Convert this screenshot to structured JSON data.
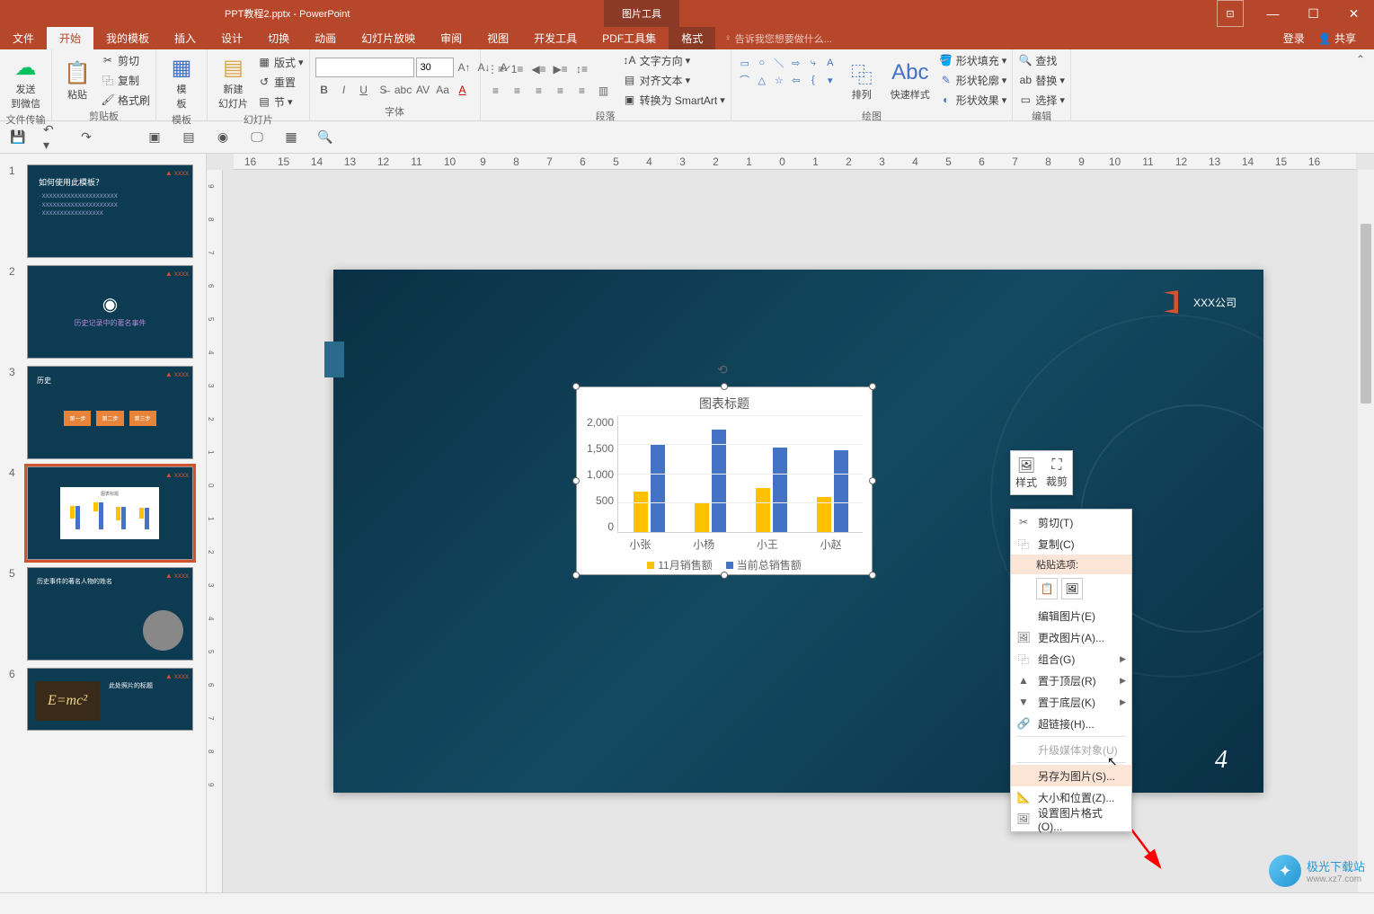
{
  "titlebar": {
    "doc_title": "PPT教程2.pptx - PowerPoint",
    "tool_tab": "图片工具",
    "ribbon_opts": "⊡"
  },
  "tabs": {
    "file": "文件",
    "home": "开始",
    "my_templates": "我的模板",
    "insert": "插入",
    "design": "设计",
    "transitions": "切换",
    "animations": "动画",
    "slideshow": "幻灯片放映",
    "review": "审阅",
    "view": "视图",
    "developer": "开发工具",
    "pdf": "PDF工具集",
    "format": "格式",
    "tell_me": "告诉我您想要做什么...",
    "login": "登录",
    "share": "共享"
  },
  "ribbon": {
    "send_wechat": "发送\n到微信",
    "file_transfer": "文件传输",
    "paste": "粘贴",
    "cut": "剪切",
    "copy": "复制",
    "format_painter": "格式刷",
    "clipboard": "剪贴板",
    "template": "模\n板",
    "template_group": "模板",
    "new_slide": "新建\n幻灯片",
    "layout": "版式",
    "reset": "重置",
    "section": "节",
    "slides": "幻灯片",
    "font_size": "30",
    "font_group": "字体",
    "paragraph": "段落",
    "text_direction": "文字方向",
    "align_text": "对齐文本",
    "smartart": "转换为 SmartArt",
    "arrange": "排列",
    "quick_styles": "快速样式",
    "shape_fill": "形状填充",
    "shape_outline": "形状轮廓",
    "shape_effects": "形状效果",
    "drawing": "绘图",
    "find": "查找",
    "replace": "替换",
    "select": "选择",
    "editing": "编辑"
  },
  "slide": {
    "company": "XXX公司",
    "page_num": "4"
  },
  "chart_data": {
    "type": "bar",
    "title": "图表标题",
    "categories": [
      "小张",
      "小杨",
      "小王",
      "小赵"
    ],
    "series": [
      {
        "name": "11月销售额",
        "values": [
          700,
          500,
          750,
          600
        ],
        "color": "#ffc000"
      },
      {
        "name": "当前总销售额",
        "values": [
          1500,
          1750,
          1450,
          1400
        ],
        "color": "#4472c4"
      }
    ],
    "ylim": [
      0,
      2000
    ],
    "yticks": [
      0,
      500,
      1000,
      1500,
      2000
    ]
  },
  "mini_toolbar": {
    "style": "样式",
    "crop": "裁剪"
  },
  "context_menu": {
    "cut": "剪切(T)",
    "copy": "复制(C)",
    "paste_options": "粘贴选项:",
    "edit_picture": "编辑图片(E)",
    "change_picture": "更改图片(A)...",
    "group": "组合(G)",
    "bring_front": "置于顶层(R)",
    "send_back": "置于底层(K)",
    "hyperlink": "超链接(H)...",
    "upgrade_media": "升级媒体对象(U)",
    "save_as_picture": "另存为图片(S)...",
    "size_position": "大小和位置(Z)...",
    "format_picture": "设置图片格式(O)..."
  },
  "watermark": {
    "text": "极光下载站",
    "url": "www.xz7.com"
  },
  "thumbs": {
    "t1_title": "如何使用此模板？",
    "t2_title": "历史记录中的著名事件",
    "t3_title": "历史",
    "t3_s1": "第一步",
    "t3_s2": "第二步",
    "t3_s3": "第三步",
    "t5_title": "历史事件的著名人物的姓名",
    "t6_title": "此处照片的标题"
  }
}
